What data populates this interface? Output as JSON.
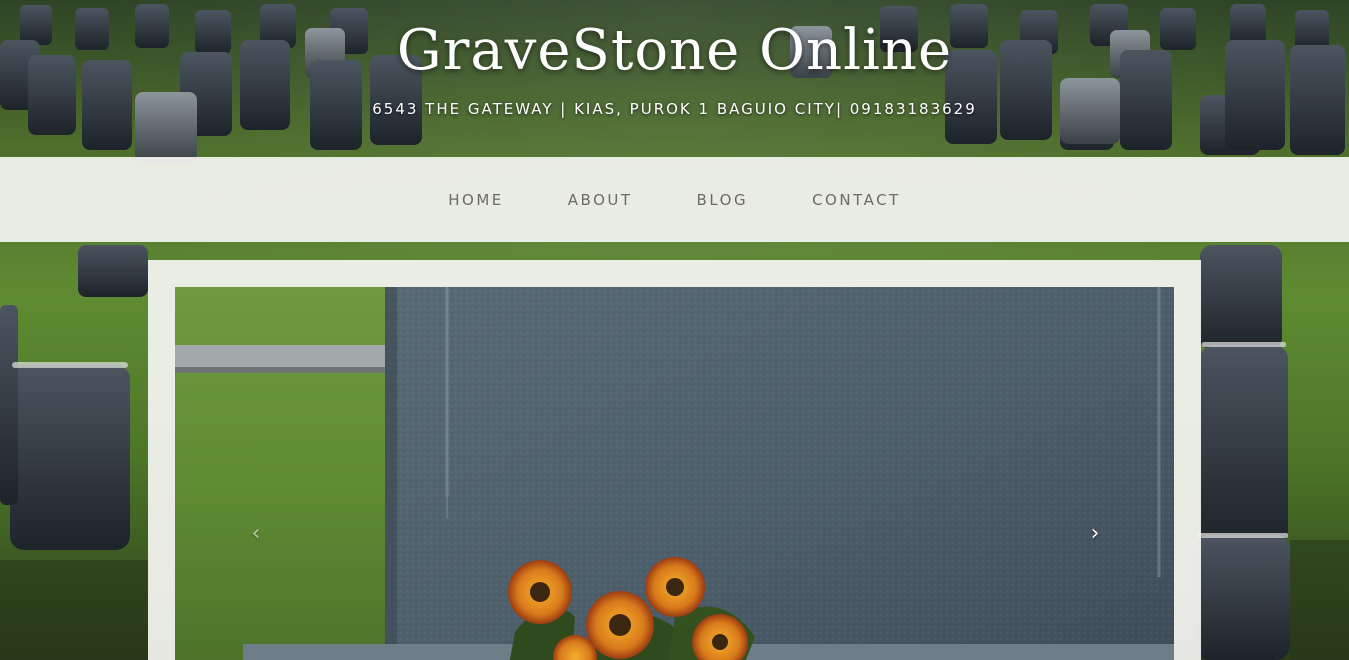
{
  "header": {
    "title": "GraveStone Online",
    "address": "6543 THE GATEWAY | KIAS, PUROK 1 BAGUIO CITY| 09183183629"
  },
  "nav": {
    "items": [
      {
        "label": "HOME"
      },
      {
        "label": "ABOUT"
      },
      {
        "label": "BLOG"
      },
      {
        "label": "CONTACT"
      }
    ]
  },
  "carousel": {
    "prev_glyph": "‹",
    "next_glyph": "›"
  },
  "colors": {
    "nav_text": "#6b6b6b",
    "title_text": "#ffffff",
    "panel_bg": "#f5f5f2"
  }
}
